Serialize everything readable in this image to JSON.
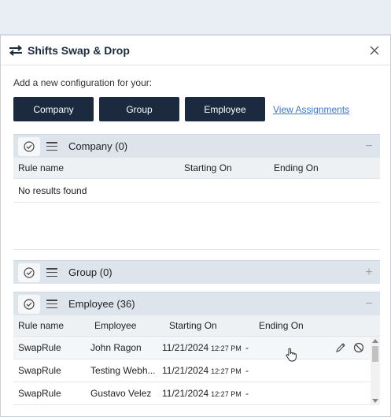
{
  "dialog": {
    "title": "Shifts Swap & Drop",
    "intro": "Add a new configuration for your:",
    "buttons": {
      "company": "Company",
      "group": "Group",
      "employee": "Employee"
    },
    "view_assignments": "View Assignments"
  },
  "company_panel": {
    "title": "Company (0)",
    "toggle": "−",
    "columns": [
      "Rule name",
      "Starting On",
      "Ending On"
    ],
    "empty_text": "No results found"
  },
  "group_panel": {
    "title": "Group (0)",
    "toggle": "+"
  },
  "employee_panel": {
    "title": "Employee (36)",
    "toggle": "−",
    "columns": [
      "Rule name",
      "Employee",
      "Starting On",
      "Ending On"
    ],
    "rows": [
      {
        "rule": "SwapRule",
        "employee": "John Ragon",
        "date": "11/21/2024",
        "time": "12:27 PM",
        "end": "-"
      },
      {
        "rule": "SwapRule",
        "employee": "Testing Webh...",
        "date": "11/21/2024",
        "time": "12:27 PM",
        "end": "-"
      },
      {
        "rule": "SwapRule",
        "employee": "Gustavo Velez",
        "date": "11/21/2024",
        "time": "12:27 PM",
        "end": "-"
      }
    ]
  },
  "icons": {
    "swap": "swap-arrows-icon",
    "close": "close-icon",
    "check": "check-circle-icon",
    "menu": "hamburger-icon",
    "edit": "pencil-icon",
    "disable": "block-icon",
    "cursor": "hand-pointer-icon"
  },
  "colors": {
    "button_bg": "#1b2a3f",
    "link": "#3d78c9",
    "panel_header": "#dde4ec",
    "column_header": "#eef1f4"
  }
}
